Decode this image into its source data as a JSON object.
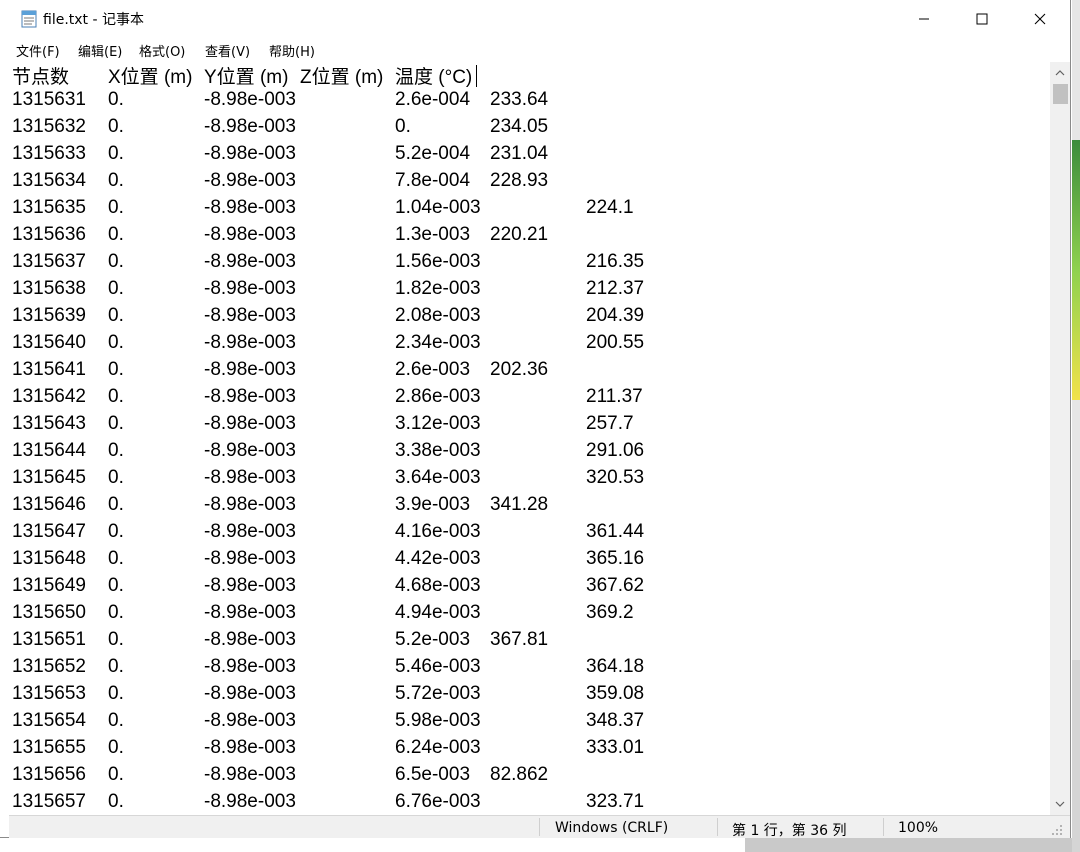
{
  "window": {
    "title": "file.txt - 记事本",
    "minimize_glyph": "—",
    "maximize_glyph": "☐",
    "close_glyph": "✕"
  },
  "menu": [
    "文件(F)",
    "编辑(E)",
    "格式(O)",
    "查看(V)",
    "帮助(H)"
  ],
  "header": {
    "col1": "节点数",
    "col2": "X位置 (m)",
    "col3": "Y位置 (m)",
    "col4": "Z位置 (m)",
    "col5": "温度 (°C)"
  },
  "rows": [
    {
      "node": "1315631",
      "x": "0.",
      "y": "-8.98e-003",
      "z": "2.6e-004",
      "t": "233.64",
      "wide": false
    },
    {
      "node": "1315632",
      "x": "0.",
      "y": "-8.98e-003",
      "z": "0.",
      "t": "234.05",
      "wide": false
    },
    {
      "node": "1315633",
      "x": "0.",
      "y": "-8.98e-003",
      "z": "5.2e-004",
      "t": "231.04",
      "wide": false
    },
    {
      "node": "1315634",
      "x": "0.",
      "y": "-8.98e-003",
      "z": "7.8e-004",
      "t": "228.93",
      "wide": false
    },
    {
      "node": "1315635",
      "x": "0.",
      "y": "-8.98e-003",
      "z": "1.04e-003",
      "t": "224.1",
      "wide": true
    },
    {
      "node": "1315636",
      "x": "0.",
      "y": "-8.98e-003",
      "z": "1.3e-003",
      "t": "220.21",
      "wide": false
    },
    {
      "node": "1315637",
      "x": "0.",
      "y": "-8.98e-003",
      "z": "1.56e-003",
      "t": "216.35",
      "wide": true
    },
    {
      "node": "1315638",
      "x": "0.",
      "y": "-8.98e-003",
      "z": "1.82e-003",
      "t": "212.37",
      "wide": true
    },
    {
      "node": "1315639",
      "x": "0.",
      "y": "-8.98e-003",
      "z": "2.08e-003",
      "t": "204.39",
      "wide": true
    },
    {
      "node": "1315640",
      "x": "0.",
      "y": "-8.98e-003",
      "z": "2.34e-003",
      "t": "200.55",
      "wide": true
    },
    {
      "node": "1315641",
      "x": "0.",
      "y": "-8.98e-003",
      "z": "2.6e-003",
      "t": "202.36",
      "wide": false
    },
    {
      "node": "1315642",
      "x": "0.",
      "y": "-8.98e-003",
      "z": "2.86e-003",
      "t": "211.37",
      "wide": true
    },
    {
      "node": "1315643",
      "x": "0.",
      "y": "-8.98e-003",
      "z": "3.12e-003",
      "t": "257.7",
      "wide": true
    },
    {
      "node": "1315644",
      "x": "0.",
      "y": "-8.98e-003",
      "z": "3.38e-003",
      "t": "291.06",
      "wide": true
    },
    {
      "node": "1315645",
      "x": "0.",
      "y": "-8.98e-003",
      "z": "3.64e-003",
      "t": "320.53",
      "wide": true
    },
    {
      "node": "1315646",
      "x": "0.",
      "y": "-8.98e-003",
      "z": "3.9e-003",
      "t": "341.28",
      "wide": false
    },
    {
      "node": "1315647",
      "x": "0.",
      "y": "-8.98e-003",
      "z": "4.16e-003",
      "t": "361.44",
      "wide": true
    },
    {
      "node": "1315648",
      "x": "0.",
      "y": "-8.98e-003",
      "z": "4.42e-003",
      "t": "365.16",
      "wide": true
    },
    {
      "node": "1315649",
      "x": "0.",
      "y": "-8.98e-003",
      "z": "4.68e-003",
      "t": "367.62",
      "wide": true
    },
    {
      "node": "1315650",
      "x": "0.",
      "y": "-8.98e-003",
      "z": "4.94e-003",
      "t": "369.2",
      "wide": true
    },
    {
      "node": "1315651",
      "x": "0.",
      "y": "-8.98e-003",
      "z": "5.2e-003",
      "t": "367.81",
      "wide": false
    },
    {
      "node": "1315652",
      "x": "0.",
      "y": "-8.98e-003",
      "z": "5.46e-003",
      "t": "364.18",
      "wide": true
    },
    {
      "node": "1315653",
      "x": "0.",
      "y": "-8.98e-003",
      "z": "5.72e-003",
      "t": "359.08",
      "wide": true
    },
    {
      "node": "1315654",
      "x": "0.",
      "y": "-8.98e-003",
      "z": "5.98e-003",
      "t": "348.37",
      "wide": true
    },
    {
      "node": "1315655",
      "x": "0.",
      "y": "-8.98e-003",
      "z": "6.24e-003",
      "t": "333.01",
      "wide": true
    },
    {
      "node": "1315656",
      "x": "0.",
      "y": "-8.98e-003",
      "z": "6.5e-003",
      "t": "82.862",
      "wide": false
    },
    {
      "node": "1315657",
      "x": "0.",
      "y": "-8.98e-003",
      "z": "6.76e-003",
      "t": "323.71",
      "wide": true
    }
  ],
  "status": {
    "encoding_line_ending": "Windows (CRLF)",
    "cursor_position": "第 1 行，第 36 列",
    "zoom": "100%"
  },
  "colors": {
    "scrollbar_track": "#f0f0f0",
    "scrollbar_thumb": "#c1c1c1",
    "statusbar_bg": "#f0f0f0"
  }
}
